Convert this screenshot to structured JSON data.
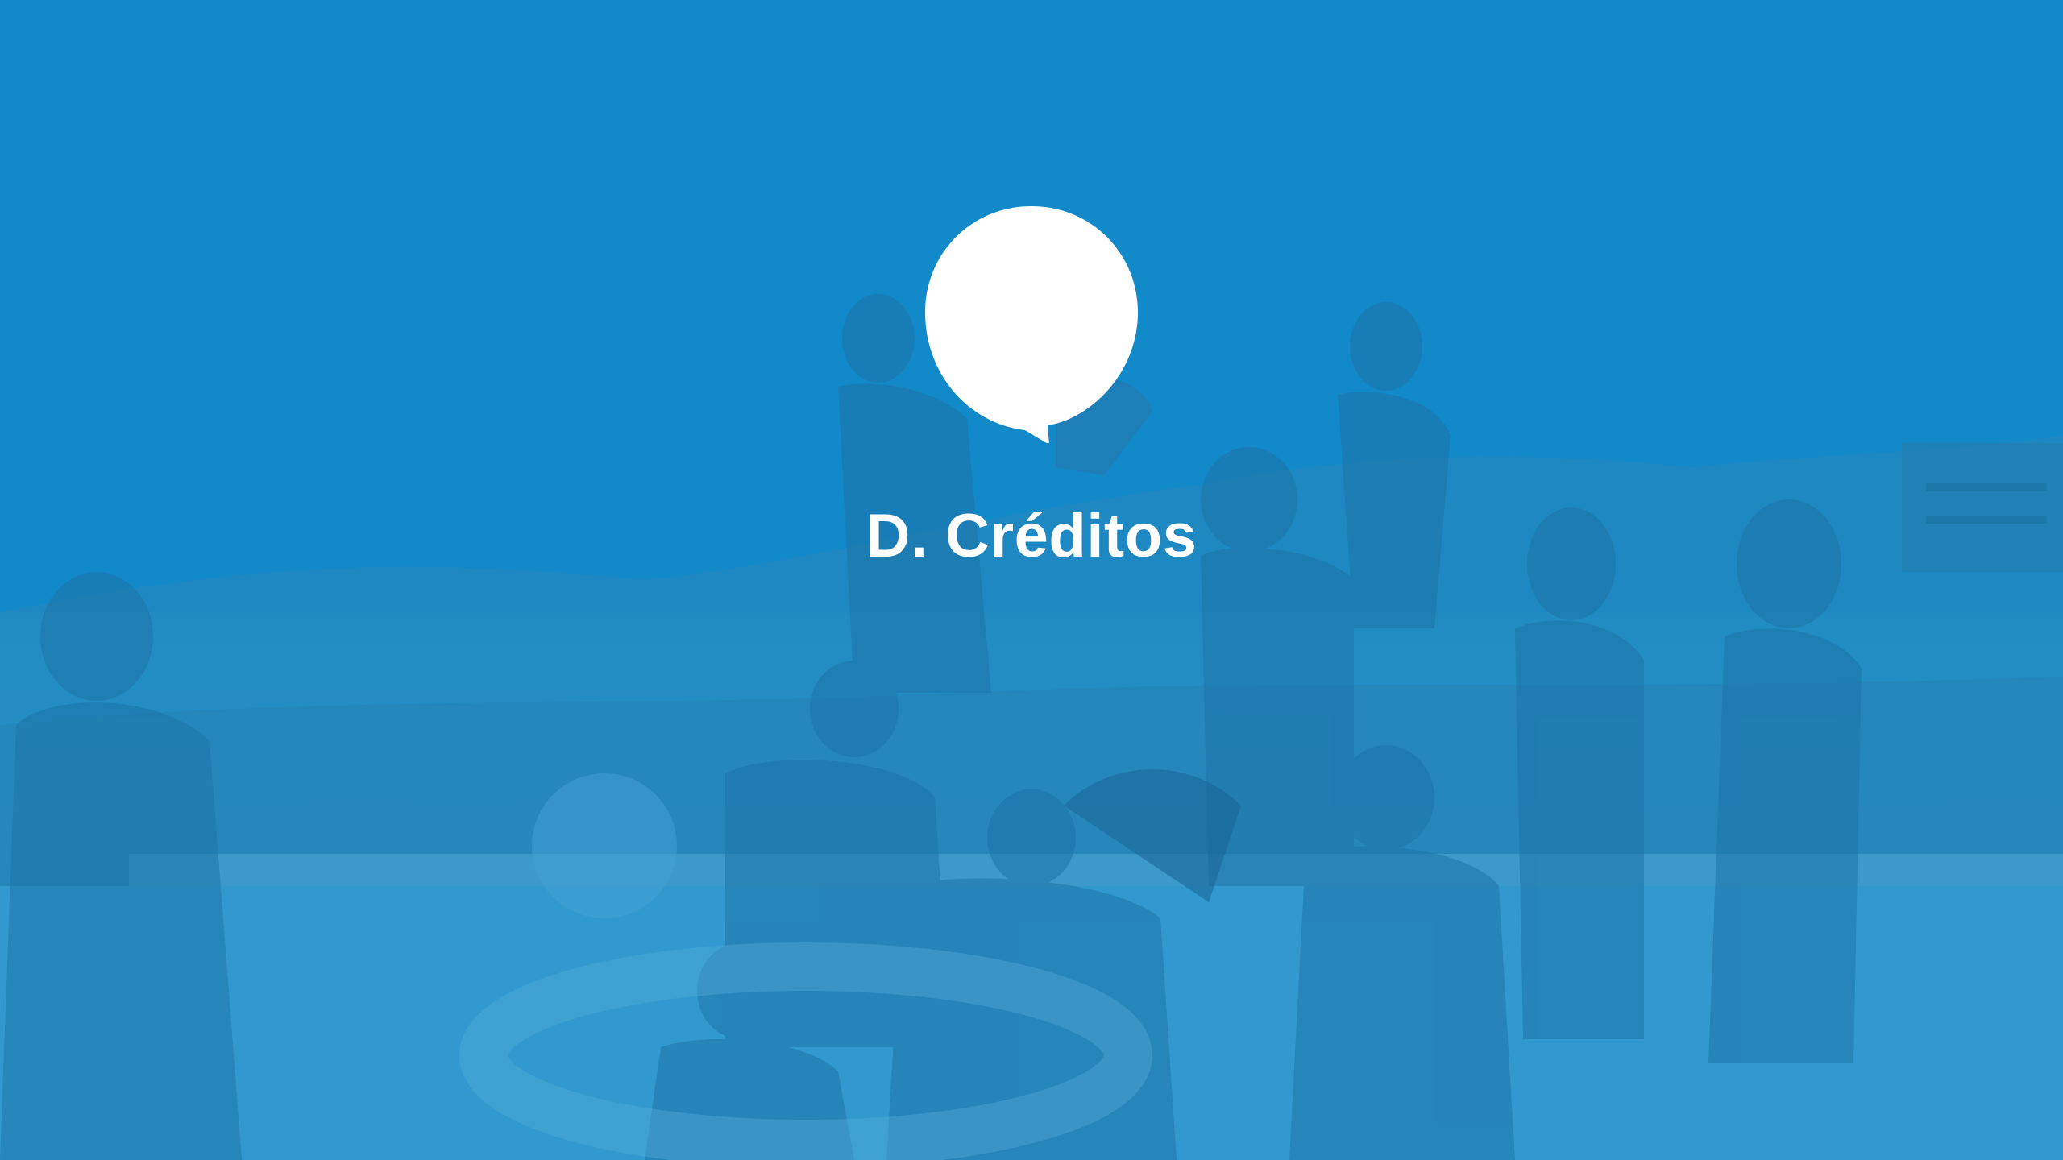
{
  "slide": {
    "title": "D. Créditos",
    "bubble_icon": "speech-bubble-icon",
    "background_scene": "pool-party-photo",
    "colors": {
      "tint": "#1590cc",
      "title_text": "#ffffff",
      "bubble": "#ffffff"
    }
  }
}
